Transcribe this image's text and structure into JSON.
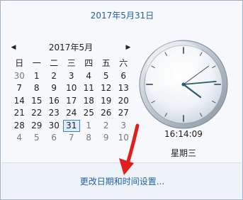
{
  "header": {
    "date_link": "2017年5月31日"
  },
  "calendar": {
    "month_title": "2017年5月",
    "prev_glyph": "◀",
    "next_glyph": "▶",
    "weekdays": [
      "日",
      "一",
      "二",
      "三",
      "四",
      "五",
      "六"
    ],
    "weeks": [
      [
        {
          "d": "30",
          "dim": true
        },
        {
          "d": "1"
        },
        {
          "d": "2"
        },
        {
          "d": "3"
        },
        {
          "d": "4"
        },
        {
          "d": "5"
        },
        {
          "d": "6"
        }
      ],
      [
        {
          "d": "7"
        },
        {
          "d": "8"
        },
        {
          "d": "9"
        },
        {
          "d": "10"
        },
        {
          "d": "11"
        },
        {
          "d": "12"
        },
        {
          "d": "13"
        }
      ],
      [
        {
          "d": "14"
        },
        {
          "d": "15"
        },
        {
          "d": "16"
        },
        {
          "d": "17"
        },
        {
          "d": "18"
        },
        {
          "d": "19"
        },
        {
          "d": "20"
        }
      ],
      [
        {
          "d": "21"
        },
        {
          "d": "22"
        },
        {
          "d": "23"
        },
        {
          "d": "24"
        },
        {
          "d": "25"
        },
        {
          "d": "26"
        },
        {
          "d": "27"
        }
      ],
      [
        {
          "d": "28"
        },
        {
          "d": "29"
        },
        {
          "d": "30"
        },
        {
          "d": "31",
          "today": true
        },
        {
          "d": "1",
          "dim": true
        },
        {
          "d": "2",
          "dim": true
        },
        {
          "d": "3",
          "dim": true
        }
      ],
      [
        {
          "d": "4",
          "dim": true
        },
        {
          "d": "5",
          "dim": true
        },
        {
          "d": "6",
          "dim": true
        },
        {
          "d": "7",
          "dim": true
        },
        {
          "d": "8",
          "dim": true
        },
        {
          "d": "9",
          "dim": true
        },
        {
          "d": "10",
          "dim": true
        }
      ]
    ]
  },
  "clock": {
    "time": "16:14:09",
    "weekday": "星期三",
    "hour": 16,
    "minute": 14,
    "second": 9
  },
  "footer": {
    "settings_link": "更改日期和时间设置..."
  },
  "colors": {
    "link": "#1f5fa8",
    "today_border": "#3c7fb1",
    "arrow": "#e02020"
  }
}
